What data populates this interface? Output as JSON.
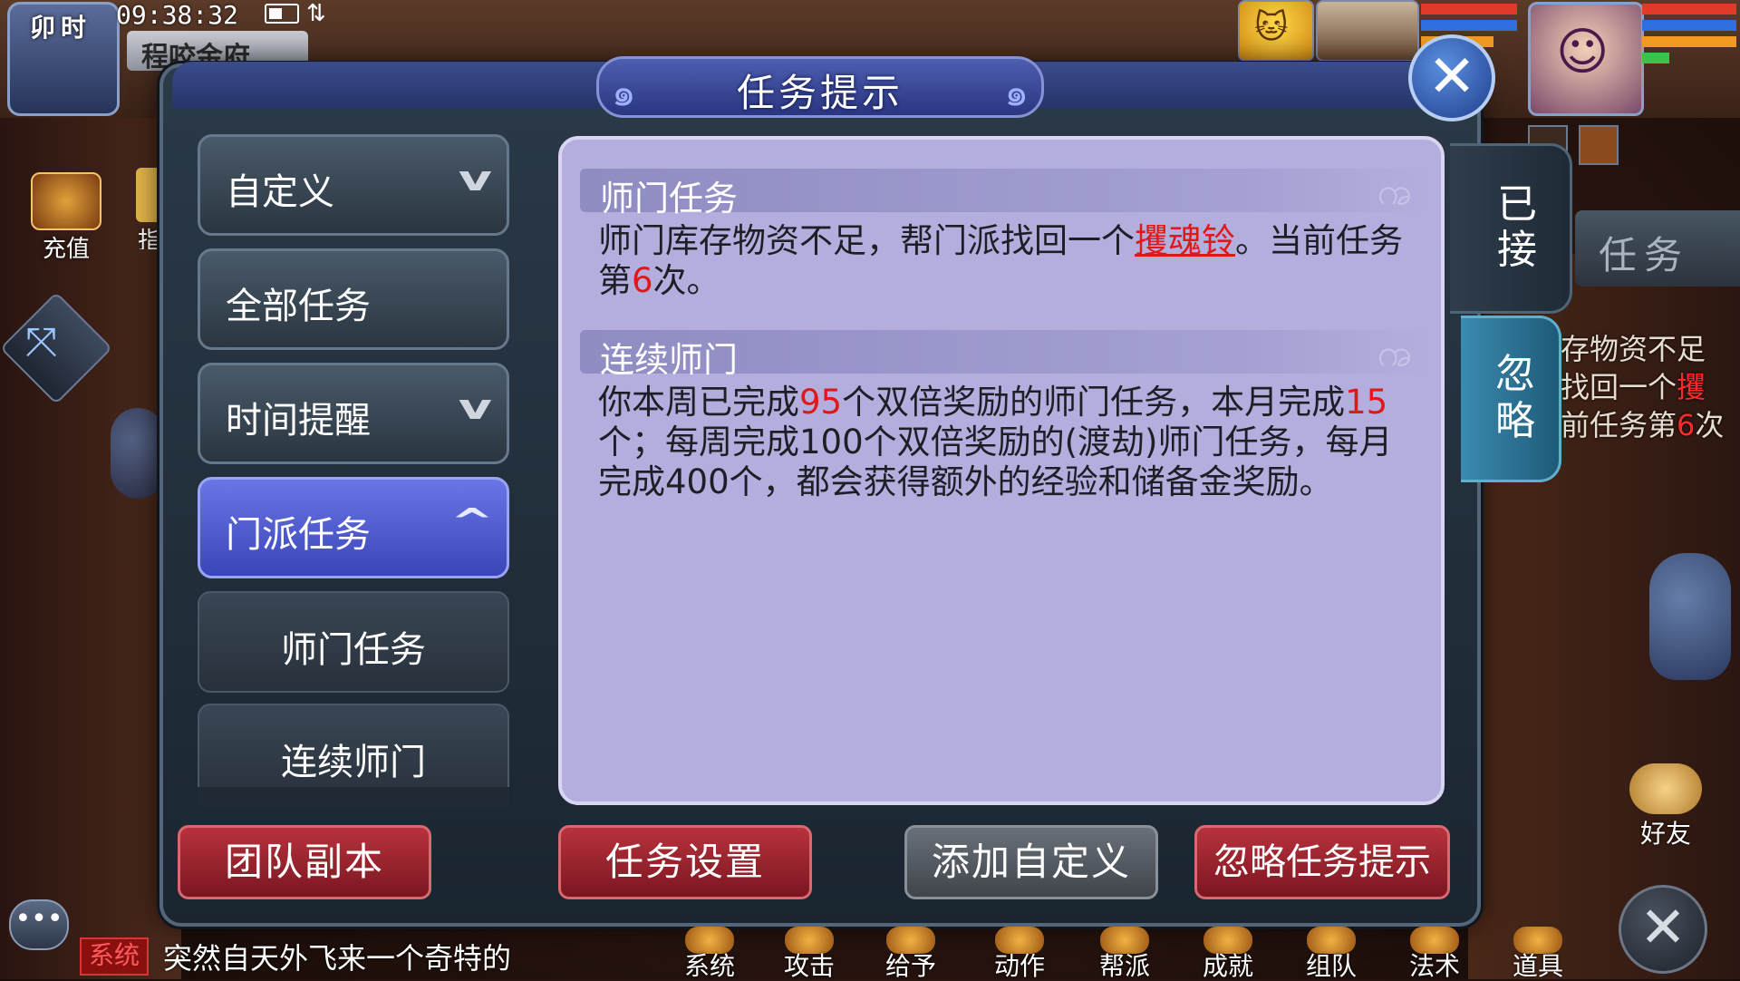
{
  "hud": {
    "shichen": "卯时",
    "time": "09:38:32",
    "location": "程咬金府",
    "recharge_label": "充值",
    "guide_label": "指"
  },
  "dialog": {
    "title": "任务提示",
    "categories": [
      {
        "label": "自定义",
        "expanded": false
      },
      {
        "label": "全部任务"
      },
      {
        "label": "时间提醒",
        "expanded": false
      },
      {
        "label": "门派任务",
        "expanded": true,
        "selected": true
      }
    ],
    "subitems": [
      "师门任务",
      "连续师门"
    ],
    "sections": [
      {
        "title": "师门任务",
        "text_before": "师门库存物资不足，帮门派找回一个",
        "item": "攫魂铃",
        "text_mid": "。当前任务第",
        "count": "6",
        "text_after": "次。"
      },
      {
        "title": "连续师门",
        "text_1": "你本周已完成",
        "week_done": "95",
        "text_2": "个双倍奖励的师门任务，本月完成",
        "month_done": "15",
        "text_3": "个；每周完成100个双倍奖励的(渡劫)师门任务，每月完成400个，都会获得额外的经验和储备金奖励。"
      }
    ],
    "buttons": {
      "team_dungeon": "团队副本",
      "task_settings": "任务设置",
      "add_custom": "添加自定义",
      "ignore_hint": "忽略任务提示"
    }
  },
  "side_tabs": {
    "accepted": "已接",
    "ignore": "忽略",
    "task": "任务"
  },
  "tracker": {
    "line1": "存物资不足",
    "line2a": "找回一个",
    "line2b": "攫",
    "line3a": "前任务第",
    "line3b": "6",
    "line3c": "次"
  },
  "chat": {
    "channel": "系统",
    "message": "突然自天外飞来一个奇特的"
  },
  "toolbar": [
    "系统",
    "攻击",
    "给予",
    "动作",
    "帮派",
    "成就",
    "组队",
    "法术",
    "道具"
  ],
  "friends_label": "好友",
  "colors": {
    "panel_bg": "#b3aedd",
    "active_category": "#5060d0",
    "highlight_red": "#e01818",
    "button_red": "#9a2430"
  }
}
